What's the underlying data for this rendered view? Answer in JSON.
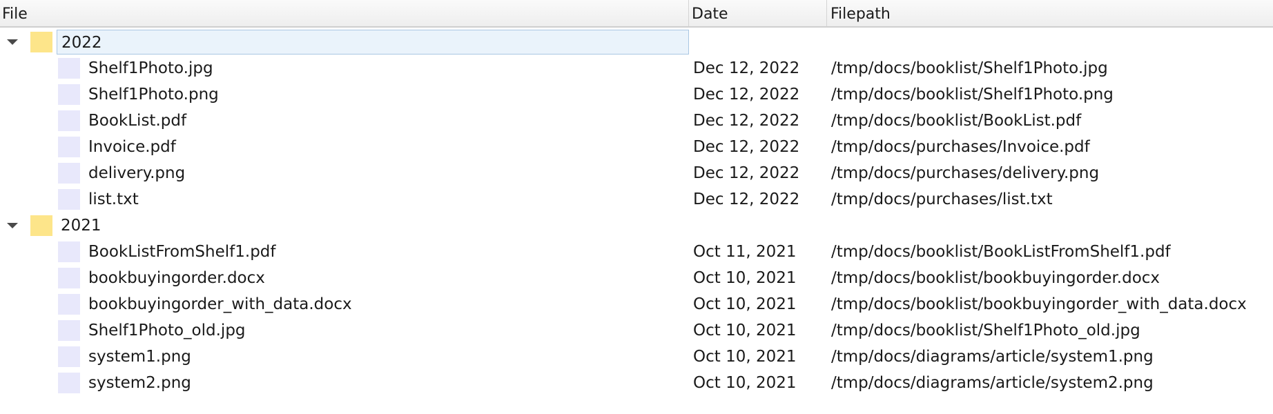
{
  "columns": {
    "file": "File",
    "date": "Date",
    "filepath": "Filepath"
  },
  "groups": [
    {
      "label": "2022",
      "files": [
        {
          "name": "Shelf1Photo.jpg",
          "date": "Dec 12, 2022",
          "path": "/tmp/docs/booklist/Shelf1Photo.jpg"
        },
        {
          "name": "Shelf1Photo.png",
          "date": "Dec 12, 2022",
          "path": "/tmp/docs/booklist/Shelf1Photo.png"
        },
        {
          "name": "BookList.pdf",
          "date": "Dec 12, 2022",
          "path": "/tmp/docs/booklist/BookList.pdf"
        },
        {
          "name": "Invoice.pdf",
          "date": "Dec 12, 2022",
          "path": "/tmp/docs/purchases/Invoice.pdf"
        },
        {
          "name": "delivery.png",
          "date": "Dec 12, 2022",
          "path": "/tmp/docs/purchases/delivery.png"
        },
        {
          "name": "list.txt",
          "date": "Dec 12, 2022",
          "path": "/tmp/docs/purchases/list.txt"
        }
      ]
    },
    {
      "label": "2021",
      "files": [
        {
          "name": "BookListFromShelf1.pdf",
          "date": "Oct 11, 2021",
          "path": "/tmp/docs/booklist/BookListFromShelf1.pdf"
        },
        {
          "name": "bookbuyingorder.docx",
          "date": "Oct 10, 2021",
          "path": "/tmp/docs/booklist/bookbuyingorder.docx"
        },
        {
          "name": "bookbuyingorder_with_data.docx",
          "date": "Oct 10, 2021",
          "path": "/tmp/docs/booklist/bookbuyingorder_with_data.docx"
        },
        {
          "name": "Shelf1Photo_old.jpg",
          "date": "Oct 10, 2021",
          "path": "/tmp/docs/booklist/Shelf1Photo_old.jpg"
        },
        {
          "name": "system1.png",
          "date": "Oct 10, 2021",
          "path": "/tmp/docs/diagrams/article/system1.png"
        },
        {
          "name": "system2.png",
          "date": "Oct 10, 2021",
          "path": "/tmp/docs/diagrams/article/system2.png"
        }
      ]
    }
  ],
  "colors": {
    "folder_icon": "#fde58a",
    "file_icon": "#e8e8fb",
    "selection_bg": "#eaf3fb",
    "selection_border": "#a9c6e2"
  }
}
